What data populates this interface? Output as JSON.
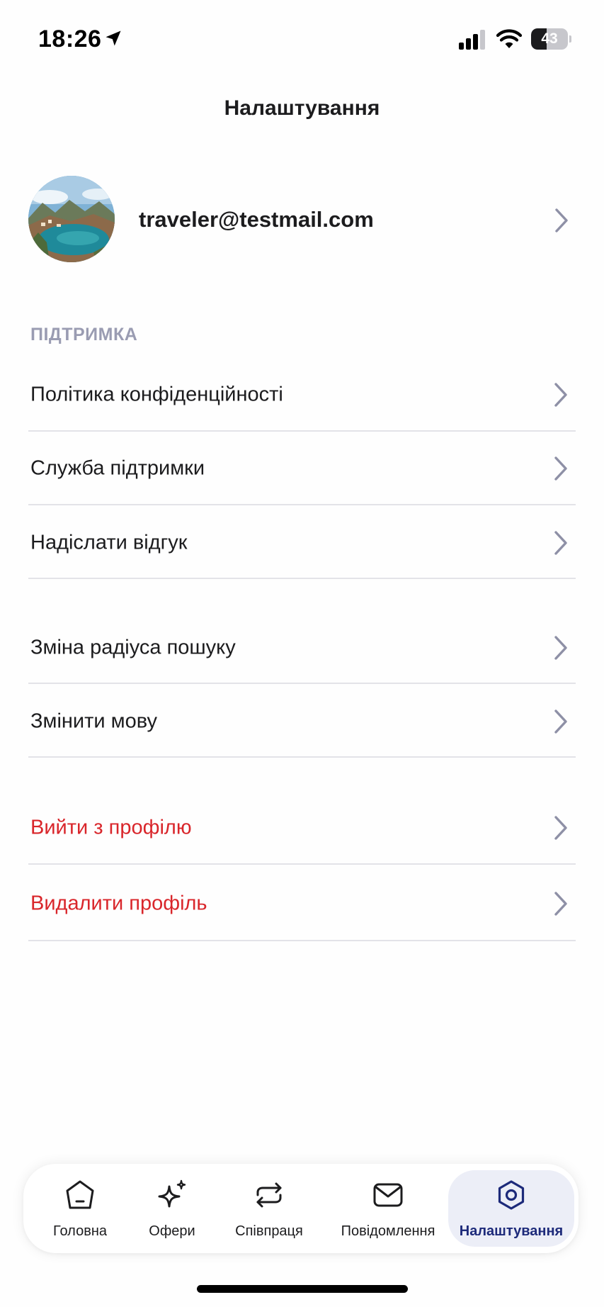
{
  "status_bar": {
    "time": "18:26",
    "battery_percent": 43,
    "battery_text": "43"
  },
  "page": {
    "title": "Налаштування"
  },
  "profile": {
    "email": "traveler@testmail.com"
  },
  "support_section": {
    "header": "ПІДТРИМКА",
    "items": [
      {
        "label": "Політика конфіденційності"
      },
      {
        "label": "Служба підтримки"
      },
      {
        "label": "Надіслати відгук"
      }
    ]
  },
  "preferences_section": {
    "items": [
      {
        "label": "Зміна радіуса пошуку"
      },
      {
        "label": "Змінити мову"
      }
    ]
  },
  "account_section": {
    "items": [
      {
        "label": "Вийти з профілю"
      },
      {
        "label": "Видалити профіль"
      }
    ]
  },
  "tab_bar": {
    "tabs": [
      {
        "label": "Головна",
        "icon": "home-icon"
      },
      {
        "label": "Офери",
        "icon": "sparkles-icon"
      },
      {
        "label": "Співпраця",
        "icon": "repeat-icon"
      },
      {
        "label": "Повідомлення",
        "icon": "mail-icon"
      },
      {
        "label": "Налаштування",
        "icon": "settings-icon",
        "active": true
      }
    ]
  },
  "colors": {
    "danger": "#d9262b",
    "section_header": "#9a9cb2",
    "active_tab": "#1d2a7a",
    "active_tab_bg": "#eceef7",
    "chevron": "#8e90a6"
  }
}
